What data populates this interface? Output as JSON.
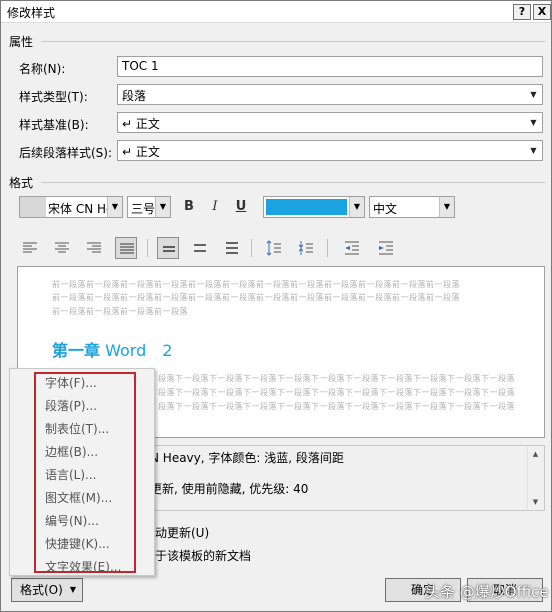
{
  "window": {
    "title": "修改样式",
    "help": "?",
    "close": "X"
  },
  "properties": {
    "section": "属性",
    "name_label": "名称(N):",
    "name_value": "TOC 1",
    "type_label": "样式类型(T):",
    "type_value": "段落",
    "based_label": "样式基准(B):",
    "based_value": "↵ 正文",
    "next_label": "后续段落样式(S):",
    "next_value": "↵ 正文"
  },
  "formatting": {
    "section": "格式",
    "font": "宋体 CN He",
    "size": "三号",
    "bold": "B",
    "italic": "I",
    "underline": "U",
    "color": "#1aa3e0",
    "language": "中文"
  },
  "preview": {
    "prev_line": "前一段落前一段落前一段落前一段落前一段落前一段落前一段落前一段落前一段落前一段落前一段落前一段落",
    "prev_line_short": "前一段落前一段落前一段落前一段落",
    "heading_bold": "第一章",
    "heading_rest": " Word　2",
    "next_line": "段落下一段落下一段落下一段落下一段落下一段落下一段落下一段落下一段落下一段落下一段落"
  },
  "description": {
    "line1": "N Heavy, 字体颜色: 浅蓝, 段落间距",
    "line2": "更新, 使用前隐藏, 优先级: 40"
  },
  "options": {
    "auto_update": "动更新(U)",
    "new_docs": "于该模板的新文档"
  },
  "menu": {
    "items": [
      "字体(F)...",
      "段落(P)...",
      "制表位(T)...",
      "边框(B)...",
      "语言(L)...",
      "图文框(M)...",
      "编号(N)...",
      "快捷键(K)...",
      "文字效果(E)..."
    ]
  },
  "buttons": {
    "format": "格式(O)",
    "ok": "确定",
    "cancel": "取消"
  },
  "watermark": "头条 @爆炒Office"
}
